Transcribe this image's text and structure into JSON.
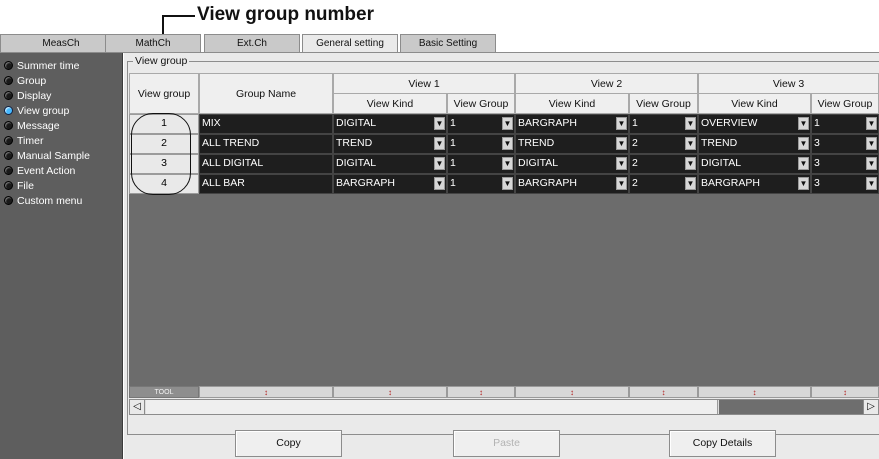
{
  "annotation": {
    "label": "View group number"
  },
  "tabs": [
    {
      "label": "MeasCh"
    },
    {
      "label": "MathCh"
    },
    {
      "label": "Ext.Ch"
    },
    {
      "label": "General setting"
    },
    {
      "label": "Basic Setting"
    }
  ],
  "sidebar": {
    "items": [
      {
        "label": "Summer time"
      },
      {
        "label": "Group"
      },
      {
        "label": "Display"
      },
      {
        "label": "View group"
      },
      {
        "label": "Message"
      },
      {
        "label": "Timer"
      },
      {
        "label": "Manual Sample"
      },
      {
        "label": "Event Action"
      },
      {
        "label": "File"
      },
      {
        "label": "Custom menu"
      }
    ]
  },
  "panel": {
    "legend": "View group",
    "headers": {
      "view_group": "View group",
      "group_name": "Group Name",
      "view1": "View 1",
      "view2": "View 2",
      "view3": "View 3",
      "view_kind": "View Kind",
      "view_group_sub": "View Group"
    },
    "rows": [
      {
        "num": "1",
        "name": "MIX",
        "v1_kind": "DIGITAL",
        "v1_group": "1",
        "v2_kind": "BARGRAPH",
        "v2_group": "1",
        "v3_kind": "OVERVIEW",
        "v3_group": "1"
      },
      {
        "num": "2",
        "name": "ALL TREND",
        "v1_kind": "TREND",
        "v1_group": "1",
        "v2_kind": "TREND",
        "v2_group": "2",
        "v3_kind": "TREND",
        "v3_group": "3"
      },
      {
        "num": "3",
        "name": "ALL DIGITAL",
        "v1_kind": "DIGITAL",
        "v1_group": "1",
        "v2_kind": "DIGITAL",
        "v2_group": "2",
        "v3_kind": "DIGITAL",
        "v3_group": "3"
      },
      {
        "num": "4",
        "name": "ALL BAR",
        "v1_kind": "BARGRAPH",
        "v1_group": "1",
        "v2_kind": "BARGRAPH",
        "v2_group": "2",
        "v3_kind": "BARGRAPH",
        "v3_group": "3"
      }
    ],
    "tool_label": "TOOL",
    "tool_glyph": "↕"
  },
  "buttons": {
    "copy": "Copy",
    "paste": "Paste",
    "copy_details": "Copy Details"
  },
  "colors": {
    "selected_indicator": "#46b9ff",
    "cell_bg": "#1e1e1e",
    "sidebar_bg": "#5e5e5e"
  }
}
